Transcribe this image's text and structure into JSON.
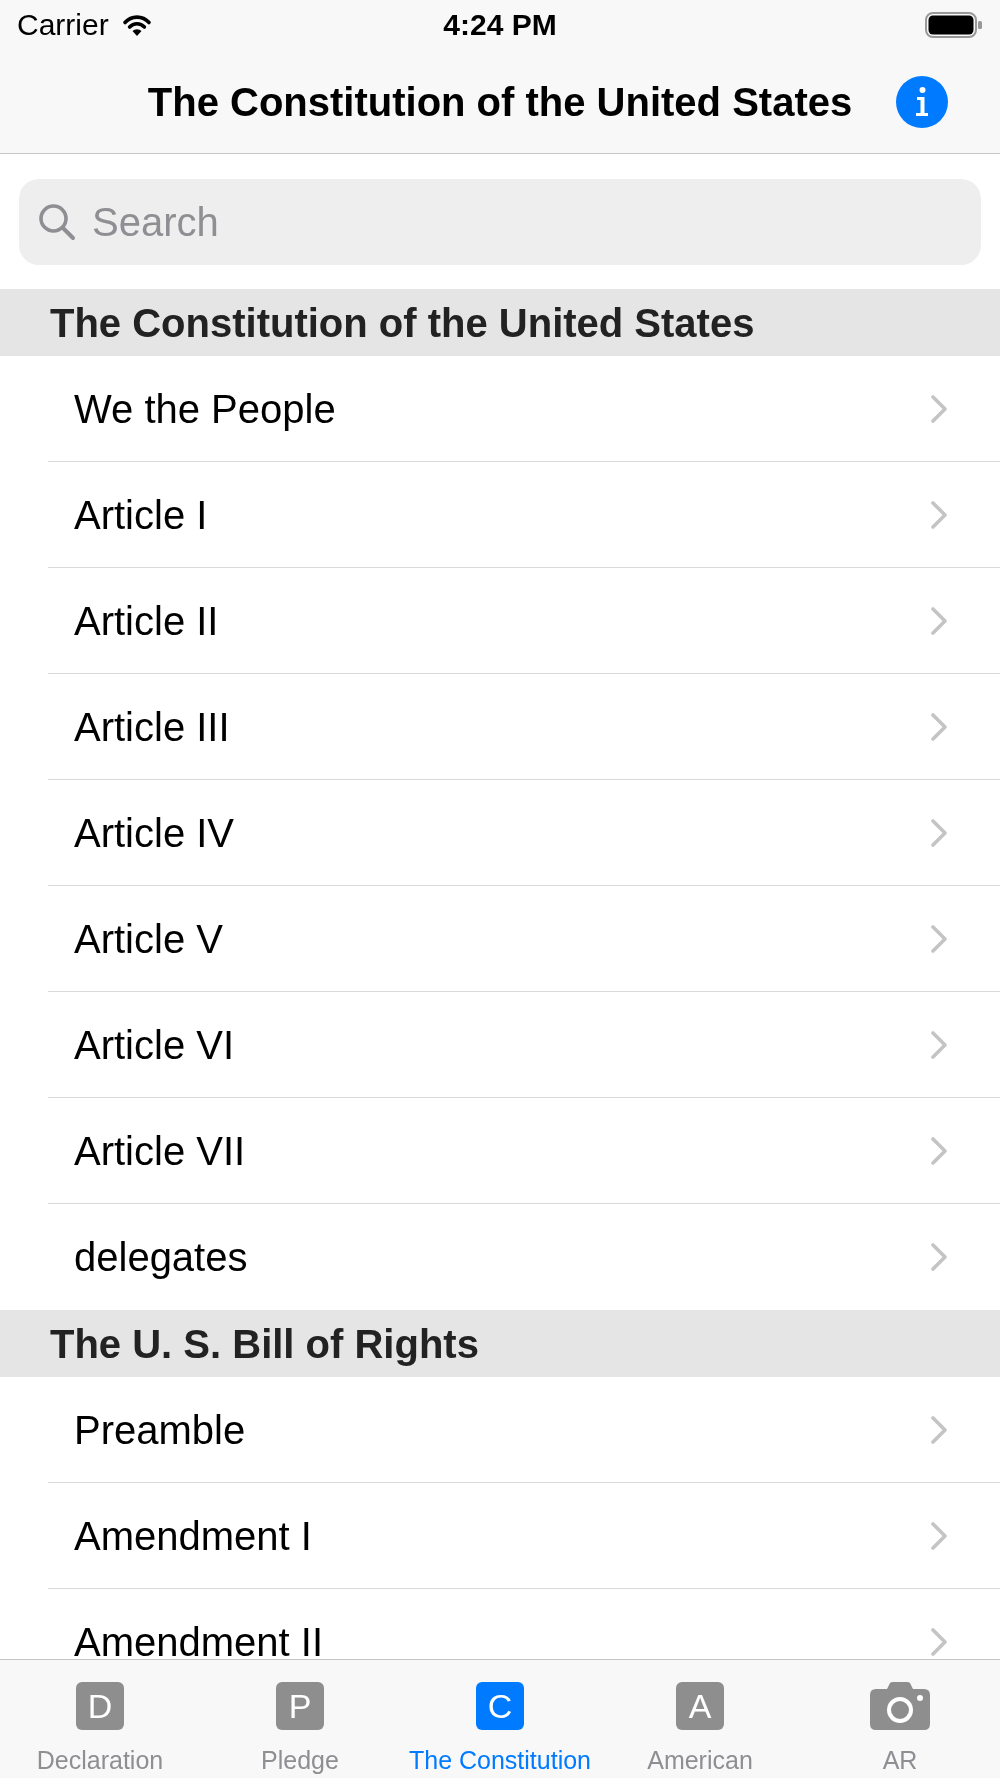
{
  "status_bar": {
    "carrier": "Carrier",
    "time": "4:24 PM"
  },
  "navigation_bar": {
    "title": "The Constitution of the United States"
  },
  "search": {
    "placeholder": "Search"
  },
  "sections": [
    {
      "title": "The Constitution of the United States",
      "rows": [
        "We the People",
        "Article I",
        "Article II",
        "Article III",
        "Article IV",
        "Article V",
        "Article VI",
        "Article VII",
        "delegates"
      ]
    },
    {
      "title": "The U. S. Bill of Rights",
      "rows": [
        "Preamble",
        "Amendment I",
        "Amendment II"
      ]
    }
  ],
  "tab_bar": {
    "tabs": [
      {
        "kind": "letter",
        "glyph": "D",
        "label": "Declaration",
        "selected": false
      },
      {
        "kind": "letter",
        "glyph": "P",
        "label": "Pledge",
        "selected": false
      },
      {
        "kind": "letter",
        "glyph": "C",
        "label": "The Constitution",
        "selected": true
      },
      {
        "kind": "letter",
        "glyph": "A",
        "label": "American",
        "selected": false
      },
      {
        "kind": "camera",
        "label": "AR",
        "selected": false
      }
    ]
  }
}
